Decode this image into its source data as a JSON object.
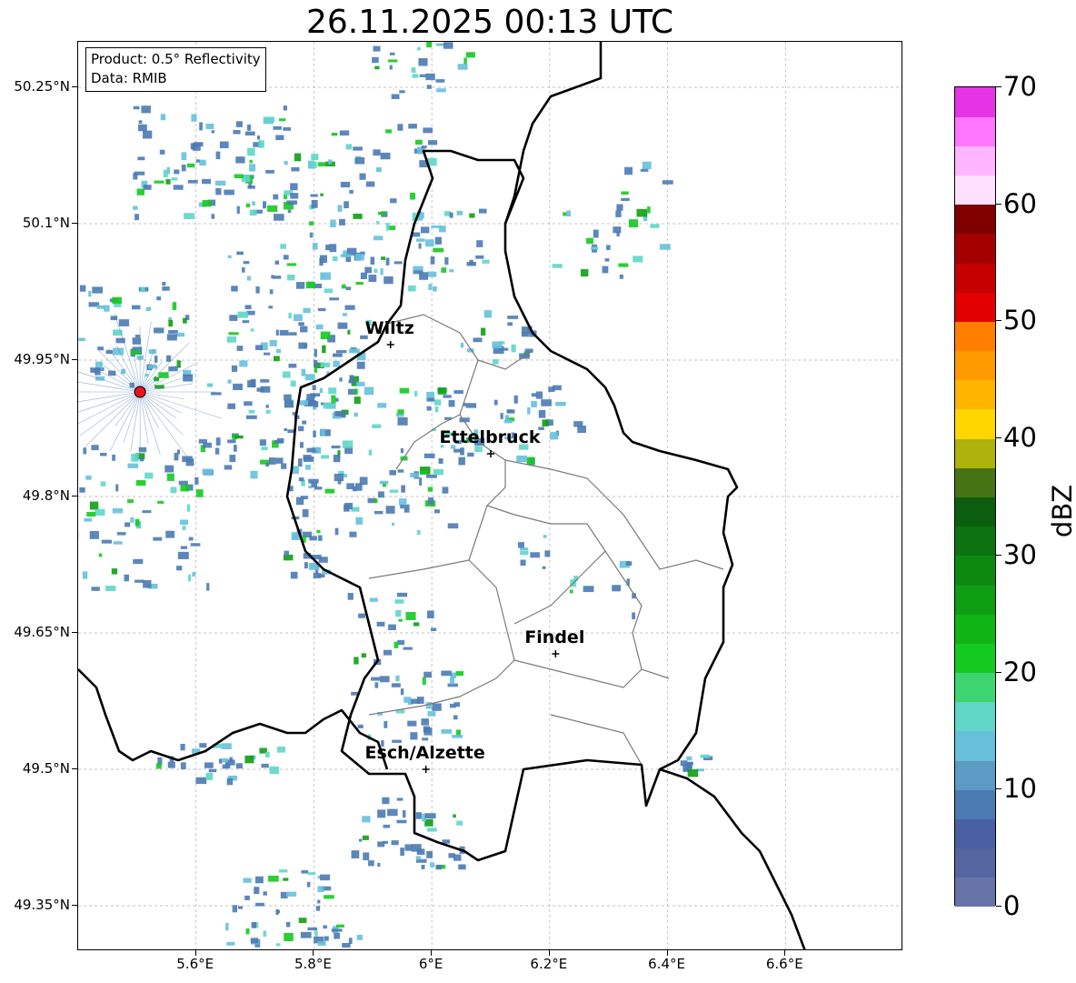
{
  "title": "26.11.2025 00:13 UTC",
  "info": {
    "product": "Product: 0.5° Reflectivity",
    "data": "Data: RMIB"
  },
  "axes": {
    "lat_labels": [
      "50.25°N",
      "50.1°N",
      "49.95°N",
      "49.8°N",
      "49.65°N",
      "49.5°N",
      "49.35°N"
    ],
    "lat_values": [
      50.25,
      50.1,
      49.95,
      49.8,
      49.65,
      49.5,
      49.35
    ],
    "lon_labels": [
      "5.6°E",
      "5.8°E",
      "6°E",
      "6.2°E",
      "6.4°E",
      "6.6°E"
    ],
    "lon_values": [
      5.6,
      5.8,
      6.0,
      6.2,
      6.4,
      6.6
    ],
    "lat_range": [
      49.3,
      50.3
    ],
    "lon_range": [
      5.4,
      6.8
    ],
    "grid": true
  },
  "cities": [
    {
      "name": "Wiltz",
      "lon": 5.93,
      "lat": 49.967
    },
    {
      "name": "Ettelbruck",
      "lon": 6.1,
      "lat": 49.847
    },
    {
      "name": "Findel",
      "lon": 6.21,
      "lat": 49.627
    },
    {
      "name": "Esch/Alzette",
      "lon": 5.99,
      "lat": 49.5
    }
  ],
  "radar_site": {
    "lon": 5.505,
    "lat": 49.915,
    "color": "#e8141c"
  },
  "colorbar": {
    "label": "dBZ",
    "min": 0,
    "max": 70,
    "tick_labels": [
      "0",
      "10",
      "20",
      "30",
      "40",
      "50",
      "60",
      "70"
    ],
    "tick_values": [
      0,
      10,
      20,
      30,
      40,
      50,
      60,
      70
    ],
    "colors": [
      "#6573a6",
      "#5566a0",
      "#4860a2",
      "#4b7ab2",
      "#5b9bc4",
      "#66c0dc",
      "#5fd6c6",
      "#3ed46f",
      "#14c91f",
      "#10b414",
      "#0e9e12",
      "#0c8a10",
      "#0b7410",
      "#0b5e0e",
      "#467314",
      "#aeb20a",
      "#ffd700",
      "#ffb400",
      "#ff9a00",
      "#ff7f00",
      "#e30000",
      "#c60000",
      "#a50000",
      "#800000",
      "#ffe0ff",
      "#ffb5ff",
      "#ff77ff",
      "#e633e6"
    ]
  },
  "colors": {
    "border_country": "#000000",
    "border_canton": "#7a7a7a",
    "grid": "#b0b0b0"
  }
}
